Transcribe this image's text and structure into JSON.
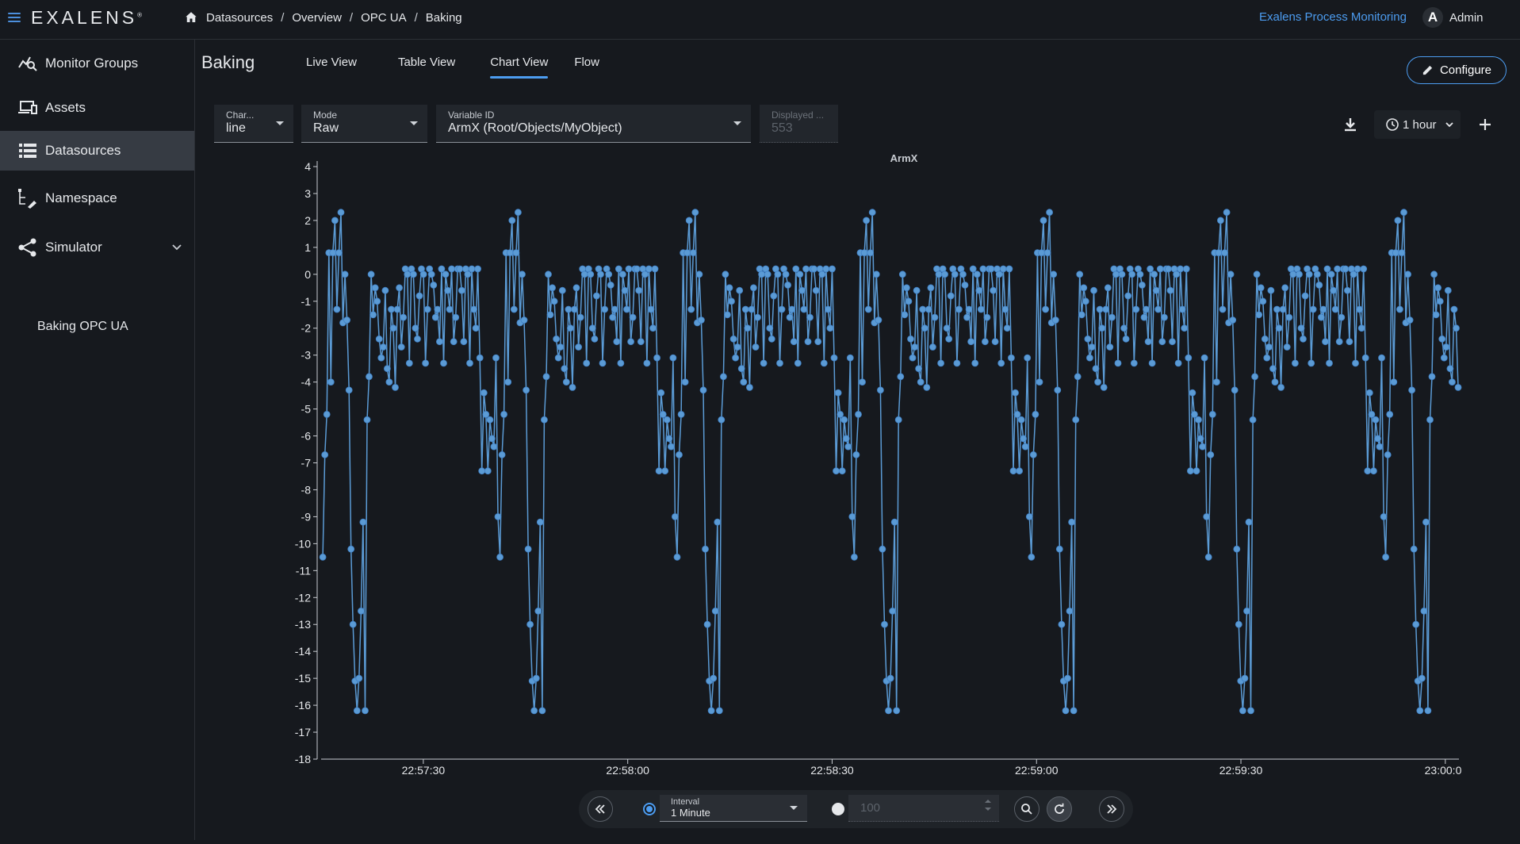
{
  "app": {
    "logo": "EXALENS",
    "logo_mark": "®",
    "app_name": "Exalens Process Monitoring",
    "user_initial": "A",
    "user_name": "Admin"
  },
  "breadcrumb": [
    "Datasources",
    "Overview",
    "OPC UA",
    "Baking"
  ],
  "sidebar": {
    "items": [
      {
        "label": "Monitor Groups",
        "icon": "monitor-groups-icon"
      },
      {
        "label": "Assets",
        "icon": "assets-icon"
      },
      {
        "label": "Datasources",
        "icon": "datasources-icon",
        "active": true
      },
      {
        "label": "Namespace",
        "icon": "namespace-icon"
      },
      {
        "label": "Simulator",
        "icon": "simulator-icon",
        "expanded": true
      }
    ],
    "sub_items": [
      "Baking OPC UA"
    ]
  },
  "page": {
    "title": "Baking",
    "tabs": [
      "Live View",
      "Table View",
      "Chart View",
      "Flow"
    ],
    "active_tab": "Chart View",
    "configure_label": "Configure"
  },
  "filters": {
    "chart_type": {
      "label": "Char...",
      "value": "line"
    },
    "mode": {
      "label": "Mode",
      "value": "Raw"
    },
    "variable": {
      "label": "Variable ID",
      "value": "ArmX (Root/Objects/MyObject)"
    },
    "displayed": {
      "label": "Displayed ...",
      "value": "553"
    },
    "time_range": "1 hour"
  },
  "bottom": {
    "interval_label": "Interval",
    "interval_value": "1 Minute",
    "count_placeholder": "100"
  },
  "colors": {
    "accent": "#4c9cf0",
    "series": "#5b9bd5",
    "background": "#16191e",
    "active_nav": "#363b43"
  },
  "chart_data": {
    "type": "line",
    "title": "ArmX",
    "xlabel": "",
    "ylabel": "",
    "ylim": [
      -18,
      4
    ],
    "yticks": [
      "4",
      "3",
      "2",
      "1",
      "0",
      "-1",
      "-2",
      "-3",
      "-4",
      "-5",
      "-6",
      "-7",
      "-8",
      "-9",
      "-10",
      "-11",
      "-12",
      "-13",
      "-14",
      "-15",
      "-16",
      "-17",
      "-18"
    ],
    "xticks": [
      "22:57:30",
      "22:58:00",
      "22:58:30",
      "22:59:00",
      "22:59:30",
      "23:00:0"
    ],
    "x_range": [
      "22:57:15",
      "23:00:02"
    ],
    "grid": false,
    "legend": "none",
    "series": [
      {
        "period_seconds": 26,
        "first_cycle_start": "22:57:12",
        "cycle_values": [
          0.2,
          -3.1,
          -7.3,
          -4.4,
          -5.2,
          -7.3,
          -5.4,
          -6.1,
          -6.4,
          -3.1,
          -9.0,
          -10.5,
          -6.7,
          -5.2,
          0.8,
          -4.0,
          0.8,
          2.0,
          -1.3,
          0.8,
          2.3,
          -1.8,
          0.0,
          -1.7,
          -4.3,
          -10.2,
          -13.0,
          -15.1,
          -16.2,
          -15.0,
          -12.5,
          -9.2,
          -16.2,
          -5.4,
          -3.8,
          0.0,
          -1.5,
          -0.5,
          -1.0,
          -2.4,
          -3.1,
          -2.7,
          -0.6,
          -3.5,
          -4.0,
          -1.3,
          -2.0,
          -4.2,
          -1.3,
          -0.5,
          -2.7,
          -1.6,
          0.2,
          0.0,
          -3.3,
          0.2,
          0.0,
          -2.0,
          -2.4,
          -0.8,
          0.2,
          0.0,
          -3.3,
          -1.3,
          0.2,
          0.0,
          -0.4,
          -1.6,
          -1.3,
          -2.5,
          0.2,
          -3.3,
          0.0,
          -0.6,
          -1.3,
          0.2,
          -2.5,
          -1.6,
          0.2,
          0.2,
          -0.6,
          -2.5,
          0.2,
          0.0,
          -3.3,
          0.2,
          -1.3,
          -2.0
        ]
      }
    ]
  }
}
